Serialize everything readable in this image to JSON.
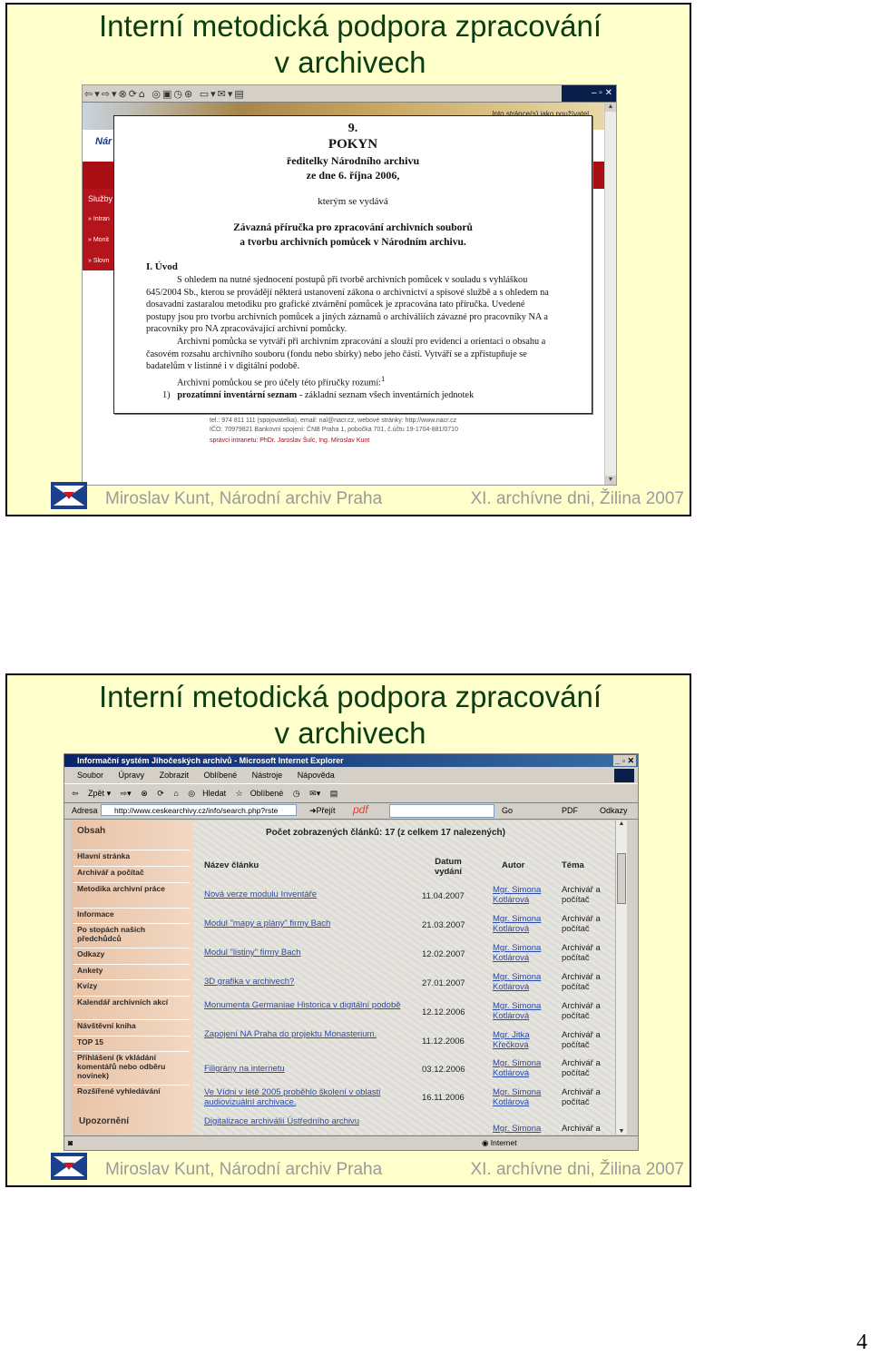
{
  "slide1": {
    "title_line1": "Interní metodická podpora zpracování",
    "title_line2": "v archivech",
    "footer_left": "Miroslav Kunt, Národní archiv Praha",
    "footer_right": "XI. archívne dni, Žilina 2007",
    "screenshot": {
      "banner_text": "Into stránce(s) jako používatel",
      "brand": "Nár",
      "sidebar_head": "Služby",
      "sidebar_items": [
        "» Intran",
        "» Monit",
        "» Slovn"
      ],
      "footer_info": [
        "tel.: 974 811 111 (spojovatelka), email: nal@nacr.cz, webové stránky: http://www.nacr.cz",
        "IČO: 70979821 Bankovní spojení: ČNB Praha 1, pobočka 701, č.účtu 19-1704-881/0710",
        "správci intranetu: PhDr. Jaroslav Šulc, Ing. Miroslav Kunt"
      ],
      "document": {
        "number": "9.",
        "heading": "POKYN",
        "issuer": "ředitelky Národního archivu",
        "date": "ze dne 6. října 2006,",
        "intro": "kterým se vydává",
        "subject_line1": "Závazná příručka pro zpracování archivních souborů",
        "subject_line2": "a tvorbu archivních pomůcek v Národním archivu.",
        "section": "I. Úvod",
        "para1": "S ohledem na nutné sjednocení postupů při tvorbě archivních pomůcek v souladu s vyhláškou 645/2004 Sb., kterou se provádějí některá ustanovení zákona o archivnictví a spisové službě a s ohledem na dosavadní zastaralou metodiku pro grafické ztvárnění pomůcek je zpracována tato příručka. Uvedené postupy jsou pro tvorbu archivních pomůcek a jiných záznamů o archiváliích závazné pro pracovníky NA a pracovníky pro NA zpracovávající archivní pomůcky.",
        "para2": "Archivní pomůcka se vytváří při archivním zpracování a slouží pro evidenci a orientaci o obsahu a časovém rozsahu archivního souboru (fondu nebo sbírky) nebo jeho částí. Vytváří se a zpřístupňuje se badatelům v listinné i v digitální podobě.",
        "para3": "Archivní pomůckou se pro účely této příručky rozumí:",
        "para3_sup": "1",
        "item1_num": "1)",
        "item1_bold": "prozatímní inventární seznam",
        "item1_rest": " - základní seznam všech inventárních jednotek"
      }
    }
  },
  "slide2": {
    "title_line1": "Interní metodická podpora zpracování",
    "title_line2": "v archivech",
    "footer_left": "Miroslav Kunt, Národní archiv Praha",
    "footer_right": "XI. archívne dni, Žilina 2007",
    "screenshot": {
      "window_title": "Informační systém Jihočeských archivů - Microsoft Internet Explorer",
      "menu": [
        "Soubor",
        "Úpravy",
        "Zobrazit",
        "Oblíbené",
        "Nástroje",
        "Nápověda"
      ],
      "toolbar": [
        "Zpět",
        "Hledat",
        "Oblíbené"
      ],
      "address_label": "Adresa",
      "address_value": "http://www.ceskearchivy.cz/info/search.php?rste",
      "go_label": "Přejít",
      "pdf_label": "pdf",
      "go2_label": "Go",
      "pdf2_label": "PDF",
      "links_label": "Odkazy",
      "sidebar_head": "Obsah",
      "sidebar_items": [
        "Hlavní stránka",
        "Archivář a počítač",
        "Metodika archivní práce",
        "Informace",
        "Po stopách našich předchůdců",
        "Odkazy",
        "Ankety",
        "Kvízy",
        "Kalendář archivních akcí",
        "Návštěvní kniha",
        "TOP 15",
        "Přihlášení (k vkládání komentářů nebo odběru novinek)",
        "Rozšířené vyhledávání"
      ],
      "sidebar_footer": "Upozornění",
      "count_text": "Počet zobrazených článků: 17 (z celkem 17 nalezených)",
      "col_title": "Název článku",
      "col_date": "Datum vydání",
      "col_author": "Autor",
      "col_topic": "Téma",
      "rows": [
        {
          "title": "Nová verze modulu Inventáře",
          "date": "11.04.2007",
          "author": "Mgr. Simona Kotlárová",
          "topic": "Archivář a počítač"
        },
        {
          "title": "Modul \"mapy a plány\" firmy Bach",
          "date": "21.03.2007",
          "author": "Mgr. Simona Kotlárová",
          "topic": "Archivář a počítač"
        },
        {
          "title": "Modul \"listiny\" firmy Bach",
          "date": "12.02.2007",
          "author": "Mgr. Simona Kotlárová",
          "topic": "Archivář a počítač"
        },
        {
          "title": "3D grafika v archivech?",
          "date": "27.01.2007",
          "author": "Mgr. Simona Kotlárová",
          "topic": "Archivář a počítač"
        },
        {
          "title": "Monumenta Germaniae Historica v digitální podobě",
          "date": "12.12.2006",
          "author": "Mgr. Simona Kotlárová",
          "topic": "Archivář a počítač"
        },
        {
          "title": "Zapojení NA Praha do projektu Monasterium.",
          "date": "11.12.2006",
          "author": "Mgr. Jitka Křečková",
          "topic": "Archivář a počítač"
        },
        {
          "title": "Filigrány na internetu",
          "date": "03.12.2006",
          "author": "Mgr. Simona Kotlárová",
          "topic": "Archivář a počítač"
        },
        {
          "title": "Ve Vídni v létě 2005 proběhlo školení v oblasti audiovizuální archivace.",
          "date": "16.11.2006",
          "author": "Mgr. Simona Kotlárová",
          "topic": "Archivář a počítač"
        },
        {
          "title": "Digitalizace archiválií Ústředního archivu",
          "date": "",
          "author": "Mgr. Simona",
          "topic": "Archivář a"
        }
      ],
      "status_zone": "Internet"
    }
  },
  "page_number": "4",
  "colors": {
    "slide_bg": "#ffffcc",
    "title": "#0a3d12",
    "footer": "#9a9a9a",
    "na_red": "#a90e15",
    "link": "#2a4aa8"
  },
  "icons": {
    "logo": "national-archive-logo",
    "toolbar": [
      "back-icon",
      "forward-icon",
      "stop-icon",
      "refresh-icon",
      "home-icon",
      "search-icon",
      "favorites-icon",
      "history-icon",
      "mail-icon",
      "print-icon"
    ]
  }
}
